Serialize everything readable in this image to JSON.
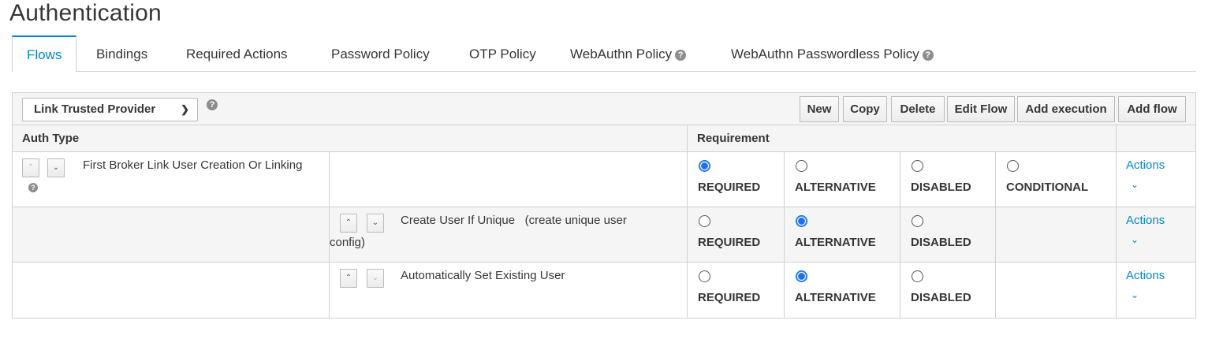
{
  "page": {
    "title": "Authentication"
  },
  "tabs": [
    {
      "label": "Flows"
    },
    {
      "label": "Bindings"
    },
    {
      "label": "Required Actions"
    },
    {
      "label": "Password Policy"
    },
    {
      "label": "OTP Policy"
    },
    {
      "label": "WebAuthn Policy"
    },
    {
      "label": "WebAuthn Passwordless Policy"
    }
  ],
  "toolbar": {
    "selected_flow": "Link Trusted Provider",
    "buttons": {
      "new": "New",
      "copy": "Copy",
      "delete": "Delete",
      "edit_flow": "Edit Flow",
      "add_execution": "Add execution",
      "add_flow": "Add flow"
    }
  },
  "table": {
    "headers": {
      "auth_type": "Auth Type",
      "requirement": "Requirement"
    },
    "req_labels": {
      "required": "REQUIRED",
      "alternative": "ALTERNATIVE",
      "disabled": "DISABLED",
      "conditional": "CONDITIONAL"
    },
    "actions_label": "Actions",
    "rows": [
      {
        "name": "First Broker Link User Creation Or Linking",
        "selected": "REQUIRED"
      },
      {
        "name": "Create User If Unique",
        "config": "(create unique user",
        "config_cont": "config)",
        "selected": "ALTERNATIVE"
      },
      {
        "name": "Automatically Set Existing User",
        "selected": "ALTERNATIVE"
      }
    ]
  },
  "colors": {
    "accent": "#0088ce",
    "radio_checked": "#1e6ff0",
    "header_bg": "#f5f5f5",
    "border": "#d1d1d1"
  },
  "icons": {
    "help": "question-circle-icon",
    "up": "chevron-up-icon",
    "down": "chevron-down-icon"
  }
}
